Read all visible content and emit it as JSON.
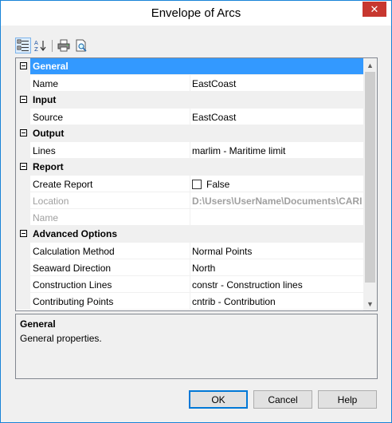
{
  "window": {
    "title": "Envelope of Arcs",
    "close_glyph": "✕"
  },
  "toolbar": {
    "buttons": [
      {
        "icon": "categorized-icon",
        "active": true
      },
      {
        "icon": "alphabetical-icon",
        "active": false
      },
      {
        "icon": "print-icon",
        "active": false
      },
      {
        "icon": "print-preview-icon",
        "active": false
      }
    ]
  },
  "property_grid": {
    "categories": [
      {
        "label": "General",
        "selected": true,
        "rows": [
          {
            "name": "Name",
            "value": "EastCoast"
          }
        ]
      },
      {
        "label": "Input",
        "rows": [
          {
            "name": "Source",
            "value": "EastCoast"
          }
        ]
      },
      {
        "label": "Output",
        "rows": [
          {
            "name": "Lines",
            "value": "marlim - Maritime limit"
          }
        ]
      },
      {
        "label": "Report",
        "rows": [
          {
            "name": "Create Report",
            "value": "False",
            "checkbox": true,
            "checked": false
          },
          {
            "name": "Location",
            "value": "D:\\Users\\UserName\\Documents\\CARI",
            "disabled": true
          },
          {
            "name": "Name",
            "value": "",
            "disabled": true
          }
        ]
      },
      {
        "label": "Advanced Options",
        "rows": [
          {
            "name": "Calculation Method",
            "value": "Normal Points"
          },
          {
            "name": "Seaward Direction",
            "value": "North"
          },
          {
            "name": "Construction Lines",
            "value": "constr - Construction lines"
          },
          {
            "name": "Contributing Points",
            "value": "cntrib - Contribution"
          }
        ]
      }
    ]
  },
  "help_panel": {
    "title": "General",
    "description": "General properties."
  },
  "buttons": {
    "ok": "OK",
    "cancel": "Cancel",
    "help": "Help"
  },
  "colors": {
    "selection": "#3399ff",
    "close_button": "#c7372f",
    "window_border": "#1883d7"
  }
}
